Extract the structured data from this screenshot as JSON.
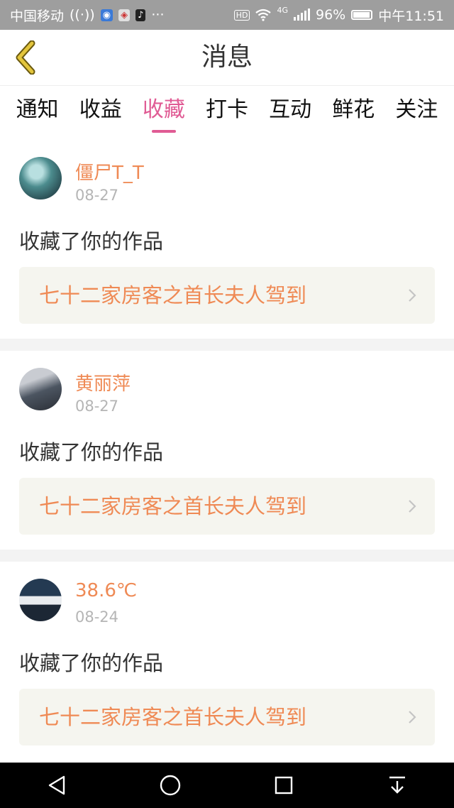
{
  "status_bar": {
    "carrier": "中国移动",
    "network": "4G",
    "battery": "96%",
    "battery_level": 0.96,
    "time": "中午11:51",
    "hd_label": "HD"
  },
  "header": {
    "title": "消息"
  },
  "tabs": [
    {
      "label": "通知",
      "active": false
    },
    {
      "label": "收益",
      "active": false
    },
    {
      "label": "收藏",
      "active": true
    },
    {
      "label": "打卡",
      "active": false
    },
    {
      "label": "互动",
      "active": false
    },
    {
      "label": "鲜花",
      "active": false
    },
    {
      "label": "关注",
      "active": false
    }
  ],
  "notifications": [
    {
      "username": "僵尸T_T",
      "date": "08-27",
      "action": "收藏了你的作品",
      "work_title": "七十二家房客之首长夫人驾到"
    },
    {
      "username": "黄丽萍",
      "date": "08-27",
      "action": "收藏了你的作品",
      "work_title": "七十二家房客之首长夫人驾到"
    },
    {
      "username": "38.6℃",
      "date": "08-24",
      "action": "收藏了你的作品",
      "work_title": "七十二家房客之首长夫人驾到"
    }
  ],
  "colors": {
    "accent_pink": "#e05b94",
    "username_orange": "#ef8a55",
    "back_arrow": "#d6b938"
  }
}
